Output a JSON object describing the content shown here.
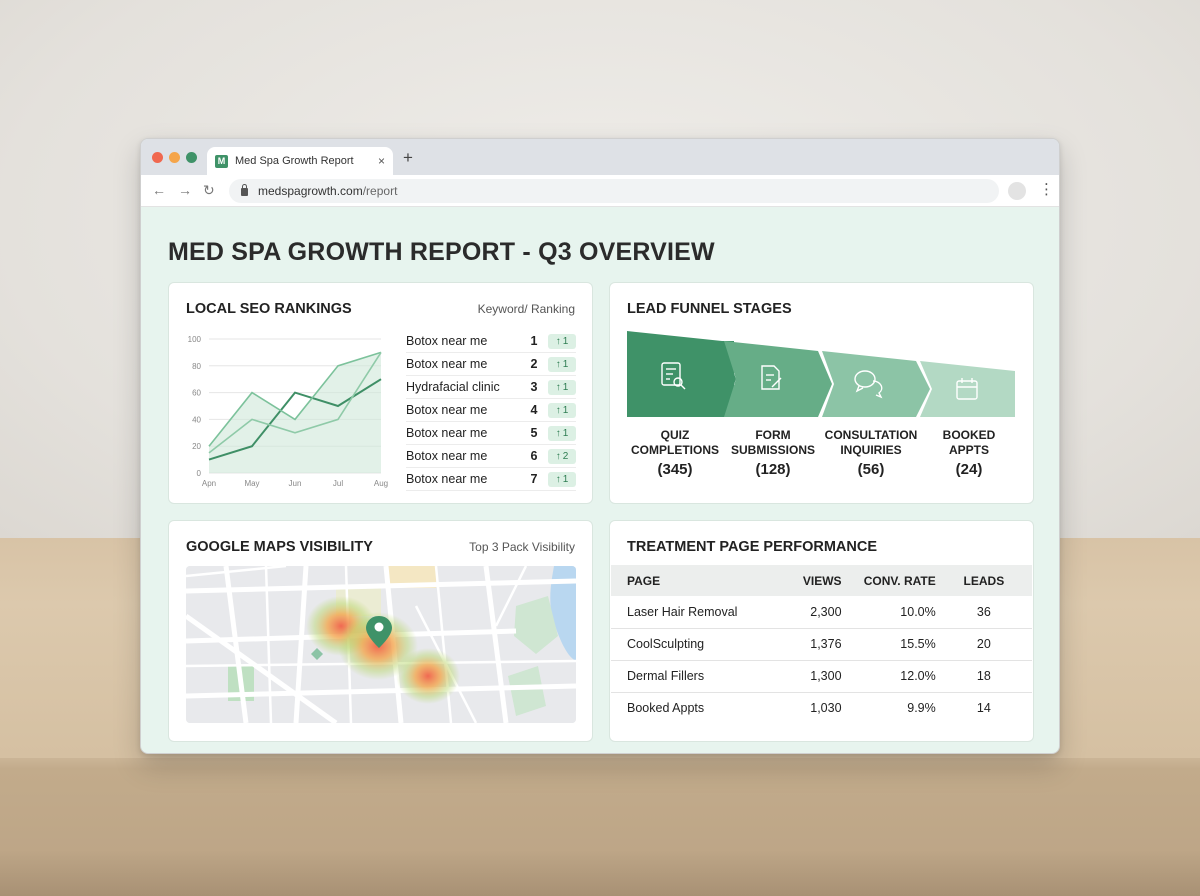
{
  "browser": {
    "tab_title": "Med Spa Growth Report",
    "tab_close": "×",
    "new_tab": "+",
    "favicon": "M",
    "url_domain": "medspagrowth.com",
    "url_path": "/report",
    "back": "←",
    "forward": "→",
    "reload": "↻",
    "menu": "⋮",
    "traffic_lights": [
      "#f0684f",
      "#f5a54a",
      "#3f9268"
    ]
  },
  "page": {
    "title": "MED SPA GROWTH REPORT - Q3 OVERVIEW"
  },
  "seo": {
    "title": "LOCAL SEO RANKINGS",
    "subtitle": "Keyword/ Ranking",
    "keywords": [
      {
        "name": "Botox near me",
        "rank": "1",
        "change": "1"
      },
      {
        "name": "Botox near me",
        "rank": "2",
        "change": "1"
      },
      {
        "name": "Hydrafacial clinic",
        "rank": "3",
        "change": "1"
      },
      {
        "name": "Botox near me",
        "rank": "4",
        "change": "1"
      },
      {
        "name": "Botox near me",
        "rank": "5",
        "change": "1"
      },
      {
        "name": "Botox near me",
        "rank": "6",
        "change": "2"
      },
      {
        "name": "Botox near me",
        "rank": "7",
        "change": "1"
      }
    ],
    "change_arrow": "↑"
  },
  "chart_data": {
    "type": "line",
    "x": [
      "Apn",
      "May",
      "Jun",
      "Jul",
      "Aug"
    ],
    "yticks": [
      "0",
      "20",
      "40",
      "60",
      "80",
      "100"
    ],
    "ylim": [
      0,
      100
    ],
    "series": [
      {
        "values": [
          10,
          20,
          60,
          50,
          70
        ],
        "color": "#3f8f66"
      },
      {
        "values": [
          20,
          60,
          40,
          80,
          90
        ],
        "color": "#7cc29b"
      },
      {
        "values": [
          15,
          40,
          30,
          40,
          90
        ],
        "color": "#8fcaa8"
      }
    ],
    "grid": true
  },
  "funnel": {
    "title": "LEAD FUNNEL STAGES",
    "stages": [
      {
        "label_l1": "QUIZ",
        "label_l2": "COMPLETIONS",
        "count": "(345)",
        "icon": "quiz-icon"
      },
      {
        "label_l1": "FORM",
        "label_l2": "SUBMISSIONS",
        "count": "(128)",
        "icon": "form-icon"
      },
      {
        "label_l1": "CONSULTATION",
        "label_l2": "INQUIRIES",
        "count": "(56)",
        "icon": "chat-icon"
      },
      {
        "label_l1": "BOOKED",
        "label_l2": "APPTS",
        "count": "(24)",
        "icon": "calendar-icon"
      }
    ],
    "colors": [
      "#3f9268",
      "#66ad87",
      "#8cc4a6",
      "#b3d9c4"
    ]
  },
  "maps": {
    "title": "GOOGLE MAPS VISIBILITY",
    "subtitle": "Top 3 Pack Visibility"
  },
  "performance": {
    "title": "TREATMENT PAGE PERFORMANCE",
    "columns": [
      "PAGE",
      "VIEWS",
      "CONV. RATE",
      "LEADS"
    ],
    "rows": [
      [
        "Laser Hair Removal",
        "2,300",
        "10.0%",
        "36"
      ],
      [
        "CoolSculpting",
        "1,376",
        "15.5%",
        "20"
      ],
      [
        "Dermal Fillers",
        "1,300",
        "12.0%",
        "18"
      ],
      [
        "Booked Appts",
        "1,030",
        "9.9%",
        "14"
      ]
    ]
  }
}
